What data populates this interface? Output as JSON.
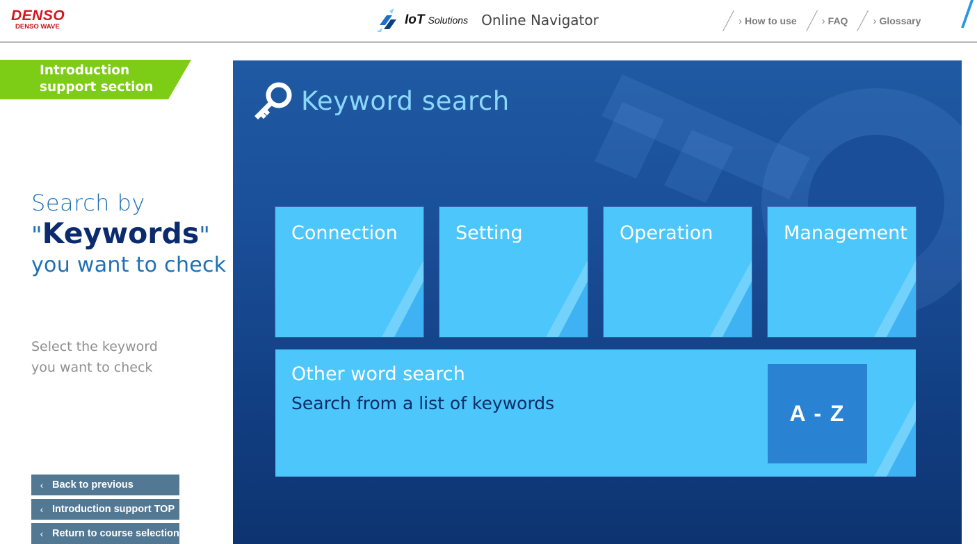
{
  "header": {
    "logo_main": "DENSO",
    "logo_sub": "DENSO WAVE",
    "brand_iot": "IoT",
    "brand_solutions": "Solutions",
    "brand_nav": "Online Navigator",
    "links": [
      {
        "label": "How to use",
        "icon": "chevron-right-icon"
      },
      {
        "label": "FAQ",
        "icon": "chevron-right-icon"
      },
      {
        "label": "Glossary",
        "icon": "chevron-right-icon"
      }
    ]
  },
  "sidebar": {
    "badge_line1": "Introduction",
    "badge_line2": "support section",
    "headline_line1": "Search by",
    "headline_quote_open": "\"",
    "headline_keyword": "Keywords",
    "headline_quote_close": "\"",
    "headline_line3": "you want to check",
    "hint_line1": "Select the keyword",
    "hint_line2": "you want to check",
    "buttons": [
      {
        "label": "Back to previous",
        "icon": "chevron-left-icon"
      },
      {
        "label": "Introduction support TOP",
        "icon": "chevron-left-icon"
      },
      {
        "label": "Return to course selection",
        "icon": "chevron-left-icon"
      }
    ]
  },
  "main": {
    "title": "Keyword search",
    "title_icon": "key-icon",
    "tiles": [
      {
        "label": "Connection"
      },
      {
        "label": "Setting"
      },
      {
        "label": "Operation"
      },
      {
        "label": "Management"
      }
    ],
    "other": {
      "title": "Other word search",
      "subtitle": "Search from a list of keywords",
      "az_label": "A - Z"
    }
  },
  "colors": {
    "accent_green": "#7dcc16",
    "panel_blue": "#1a4e98",
    "tile_cyan": "#4cc6fb",
    "az_blue": "#2a82d3",
    "sidebar_button": "#537893",
    "logo_red": "#d7141f"
  }
}
